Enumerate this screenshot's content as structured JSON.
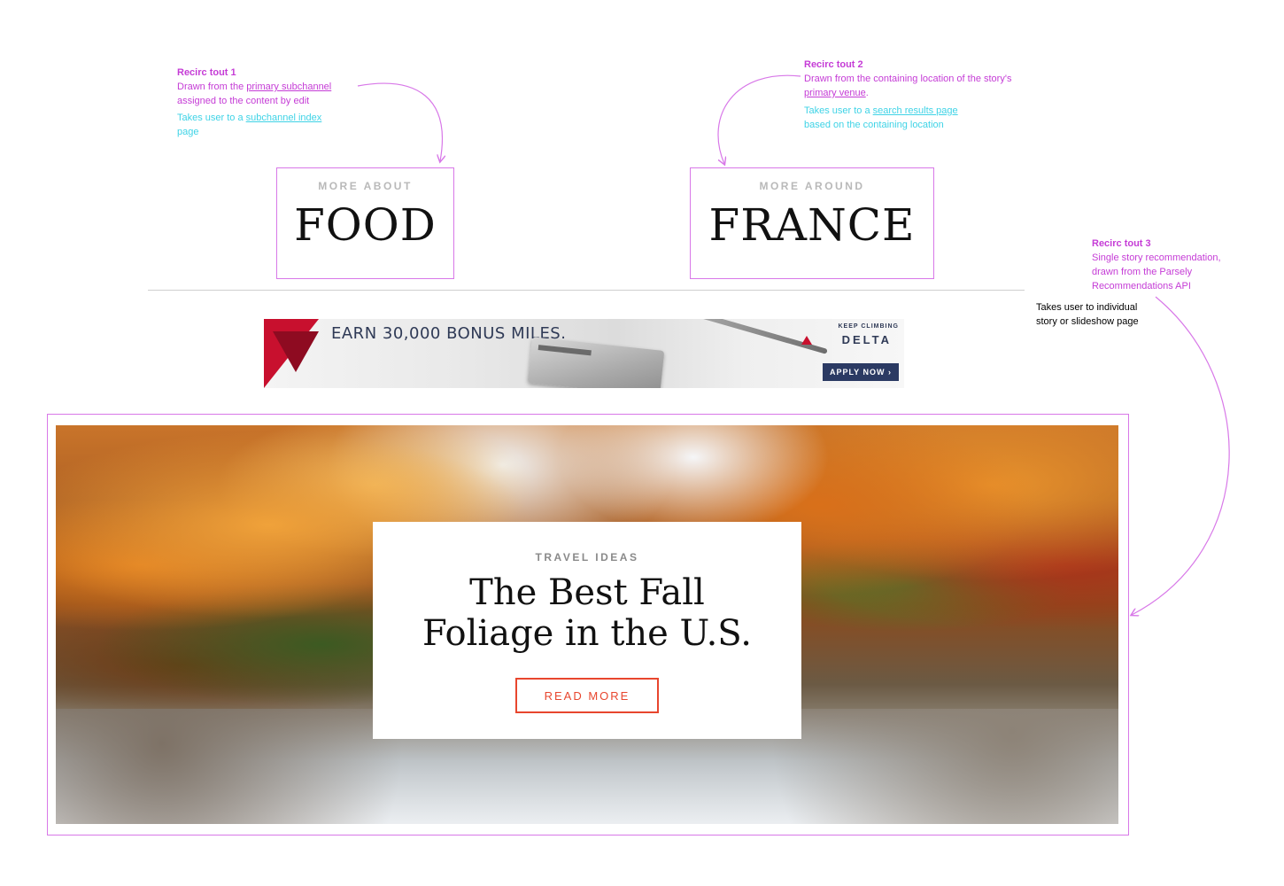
{
  "annotations": {
    "tout1": {
      "title": "Recirc tout 1",
      "desc_pre": "Drawn from the ",
      "desc_link": "primary subchannel",
      "desc_post": "assigned to the content by edit",
      "action_pre": "Takes user to a ",
      "action_link": "subchannel index",
      "action_post": "page"
    },
    "tout2": {
      "title": "Recirc tout 2",
      "desc_pre": "Drawn from the containing location of the story's",
      "desc_link": "primary venue",
      "desc_post": ".",
      "action_pre": "Takes user to a ",
      "action_link": "search results page",
      "action_post": "based on the containing location"
    },
    "tout3": {
      "title": "Recirc tout 3",
      "desc_line1": "Single story recommendation,",
      "desc_line2": "drawn from the Parsely",
      "desc_line3": "Recommendations API",
      "action_line1": "Takes user to individual",
      "action_line2": "story or slideshow page"
    }
  },
  "tout_food": {
    "eyebrow": "MORE ABOUT",
    "word": "FOOD"
  },
  "tout_france": {
    "eyebrow": "MORE AROUND",
    "word": "FRANCE"
  },
  "ad": {
    "headline": "EARN 30,000 BONUS MILES.",
    "tagline": "KEEP CLIMBING",
    "brand": "DELTA",
    "cta": "APPLY NOW ›"
  },
  "hero": {
    "eyebrow": "TRAVEL IDEAS",
    "title": "The Best Fall Foliage in the U.S.",
    "button": "READ MORE"
  },
  "colors": {
    "annotation_magenta": "#c53cd6",
    "annotation_cyan": "#3fd3e6",
    "frame_border": "#d878e8",
    "cta_red": "#e8462e"
  }
}
